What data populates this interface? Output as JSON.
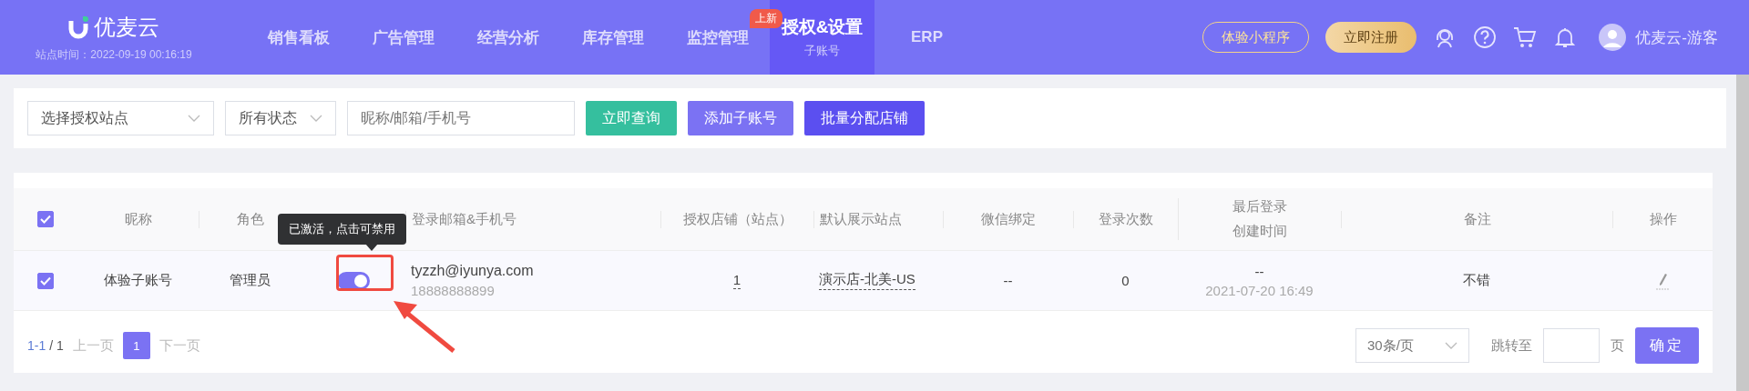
{
  "brand": {
    "name": "优麦云",
    "site_time": "站点时间：2022-09-19 00:16:19"
  },
  "nav": [
    {
      "label": "销售看板",
      "selected": false
    },
    {
      "label": "广告管理",
      "selected": false
    },
    {
      "label": "经营分析",
      "selected": false
    },
    {
      "label": "库存管理",
      "selected": false
    },
    {
      "label": "监控管理",
      "selected": false
    },
    {
      "label": "授权&设置",
      "sub": "子账号",
      "badge": "上新",
      "selected": true
    },
    {
      "label": "ERP",
      "selected": false
    }
  ],
  "header_buttons": [
    {
      "label": "体验小程序",
      "kind": "outline"
    },
    {
      "label": "立即注册",
      "kind": "gold"
    }
  ],
  "user": "优麦云-游客",
  "filters": {
    "site": {
      "placeholder": "选择授权站点"
    },
    "status": {
      "value": "所有状态"
    },
    "search": {
      "placeholder": "昵称/邮箱/手机号"
    },
    "buttons": [
      {
        "label": "立即查询",
        "kind": "query"
      },
      {
        "label": "添加子账号",
        "kind": "add"
      },
      {
        "label": "批量分配店铺",
        "kind": "batch"
      }
    ]
  },
  "table": {
    "all_checked": true,
    "columns": [
      [
        "昵称"
      ],
      [
        "角色"
      ],
      [],
      [
        "登录邮箱&手机号"
      ],
      [
        "授权店铺（站点）"
      ],
      [
        "默认展示站点"
      ],
      [
        "微信绑定"
      ],
      [
        "登录次数"
      ],
      [
        "最后登录",
        "创建时间"
      ],
      [
        "备注"
      ],
      [
        "操作"
      ]
    ],
    "rows": [
      {
        "checked": true,
        "nickname": "体验子账号",
        "role": "管理员",
        "active": true,
        "email": "tyzzh@iyunya.com",
        "phone": "18888888899",
        "stores": "1",
        "default_site": "演示店-北美-US",
        "wechat": "--",
        "login_count": "0",
        "last_login": "--",
        "created": "2021-07-20 16:49",
        "note": "不错"
      }
    ]
  },
  "tooltip": "已激活，点击可禁用",
  "pagination": {
    "range": "1-1",
    "total": "/ 1",
    "prev": "上一页",
    "pages": [
      {
        "label": "1",
        "selected": true
      }
    ],
    "next": "下一页",
    "page_size": "30条/页",
    "jump": "跳转至",
    "unit": "页",
    "confirm": "确定"
  }
}
